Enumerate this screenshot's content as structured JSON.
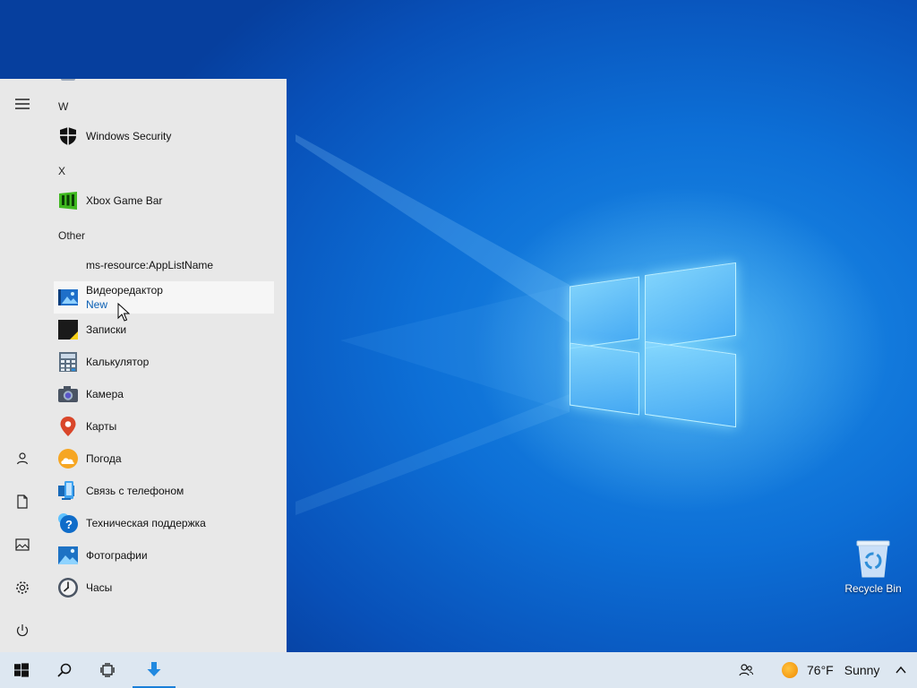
{
  "desktop": {
    "recycle_bin_label": "Recycle Bin"
  },
  "start_menu": {
    "partial_top_icon": "app-icon-partial",
    "sections": [
      {
        "letter": "W",
        "apps": [
          {
            "name": "Windows Security",
            "icon": "shield-icon"
          }
        ]
      },
      {
        "letter": "X",
        "apps": [
          {
            "name": "Xbox Game Bar",
            "icon": "xbox-game-bar-icon"
          }
        ]
      },
      {
        "letter": "Other",
        "apps": [
          {
            "name": "ms-resource:AppListName",
            "icon": ""
          },
          {
            "name": "Видеоредактор",
            "sub": "New",
            "icon": "video-editor-icon",
            "hover": true
          },
          {
            "name": "Записки",
            "icon": "sticky-notes-icon"
          },
          {
            "name": "Калькулятор",
            "icon": "calculator-icon"
          },
          {
            "name": "Камера",
            "icon": "camera-icon"
          },
          {
            "name": "Карты",
            "icon": "maps-pin-icon"
          },
          {
            "name": "Погода",
            "icon": "weather-icon"
          },
          {
            "name": "Связь с телефоном",
            "icon": "phone-link-icon"
          },
          {
            "name": "Техническая поддержка",
            "icon": "get-help-icon"
          },
          {
            "name": "Фотографии",
            "icon": "photos-icon"
          },
          {
            "name": "Часы",
            "icon": "clock-icon"
          }
        ]
      }
    ],
    "rail": [
      "hamburger-menu-icon",
      "user-icon",
      "documents-icon",
      "pictures-icon",
      "settings-gear-icon",
      "power-icon"
    ]
  },
  "taskbar": {
    "buttons": [
      "windows-start-icon",
      "search-icon",
      "task-view-icon",
      "download-arrow-icon"
    ],
    "tray": {
      "people_icon": "people-icon",
      "weather_temp": "76°F",
      "weather_condition": "Sunny",
      "chevron_icon": "chevron-up-icon"
    }
  },
  "colors": {
    "accent": "#1a7fd8",
    "start_menu_bg": "#e8e8e8",
    "taskbar_bg": "#dde7f1",
    "new_tag": "#0a5fb4"
  }
}
